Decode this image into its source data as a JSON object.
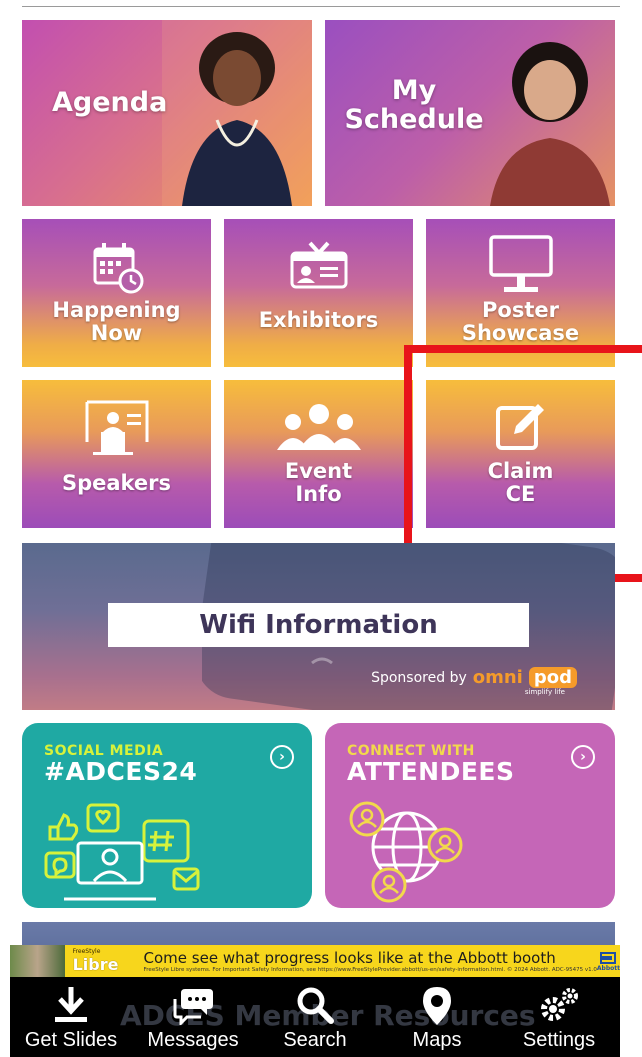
{
  "hero": {
    "agenda": "Agenda",
    "my_schedule": "My\nSchedule"
  },
  "tiles": {
    "happening_now": "Happening\nNow",
    "exhibitors": "Exhibitors",
    "poster_showcase": "Poster\nShowcase",
    "speakers": "Speakers",
    "event_info": "Event\nInfo",
    "claim_ce": "Claim\nCE"
  },
  "wifi": {
    "title": "Wifi Information",
    "sponsored_by": "Sponsored by",
    "sponsor_name_a": "omni",
    "sponsor_name_b": "pod",
    "tagline": "simplify life"
  },
  "cards": {
    "social_small": "SOCIAL MEDIA",
    "social_big": "#ADCES24",
    "connect_small": "CONNECT WITH",
    "connect_big": "ATTENDEES"
  },
  "member_resources": "ADCES Member Resources",
  "ad": {
    "brand_small": "FreeStyle",
    "brand_big": "Libre",
    "main_text": "Come see what progress looks like at the Abbott booth",
    "fine_print": "FreeStyle Libre systems. For Important Safety Information, see https://www.FreeStyleProvider.abbott/us-en/safety-information.html. © 2024 Abbott. ADC-95475 v1.0",
    "abbott": "Abbott"
  },
  "tabs": [
    {
      "label": "Get Slides"
    },
    {
      "label": "Messages"
    },
    {
      "label": "Search"
    },
    {
      "label": "Maps"
    },
    {
      "label": "Settings"
    }
  ],
  "colors": {
    "highlight": "#e8141a",
    "social_card": "#1fa9a3",
    "connect_card": "#c566b7",
    "social_accent": "#d7f23b",
    "connect_accent": "#f2d94b"
  }
}
